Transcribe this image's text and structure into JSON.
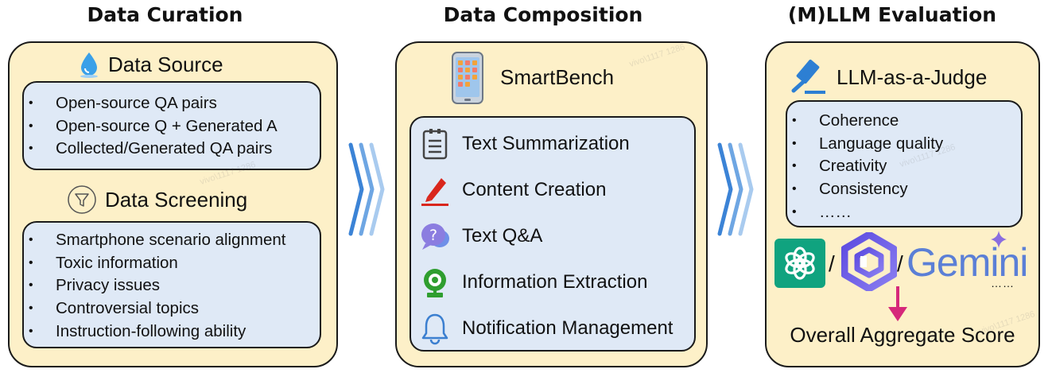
{
  "columns": {
    "curation": {
      "title": "Data Curation",
      "source_heading": "Data Source",
      "source_items": [
        "Open-source QA pairs",
        "Open-source Q + Generated A",
        "Collected/Generated QA pairs"
      ],
      "screening_heading": "Data Screening",
      "screening_items": [
        "Smartphone scenario alignment",
        "Toxic information",
        "Privacy issues",
        "Controversial topics",
        "Instruction-following ability"
      ]
    },
    "composition": {
      "title": "Data Composition",
      "bench_name": "SmartBench",
      "tasks": [
        "Text Summarization",
        "Content Creation",
        "Text Q&A",
        "Information Extraction",
        "Notification Management"
      ]
    },
    "evaluation": {
      "title": "(M)LLM Evaluation",
      "judge_heading": "LLM-as-a-Judge",
      "criteria": [
        "Coherence",
        "Language quality",
        "Creativity",
        "Consistency",
        "……"
      ],
      "separator": "/",
      "gemini_label": "Gemini",
      "more_models": "……",
      "score_label": "Overall Aggregate Score"
    }
  },
  "watermark": "vivo\\1117 1286",
  "colors": {
    "panel_bg": "#fdf0c8",
    "inner_bg": "#dfe9f6",
    "chevron": "#3b83d6",
    "accent_red": "#d9261c",
    "arrow_pink": "#d6287a",
    "openai_green": "#10a37f",
    "gemini_blue": "#5b7fd6"
  }
}
